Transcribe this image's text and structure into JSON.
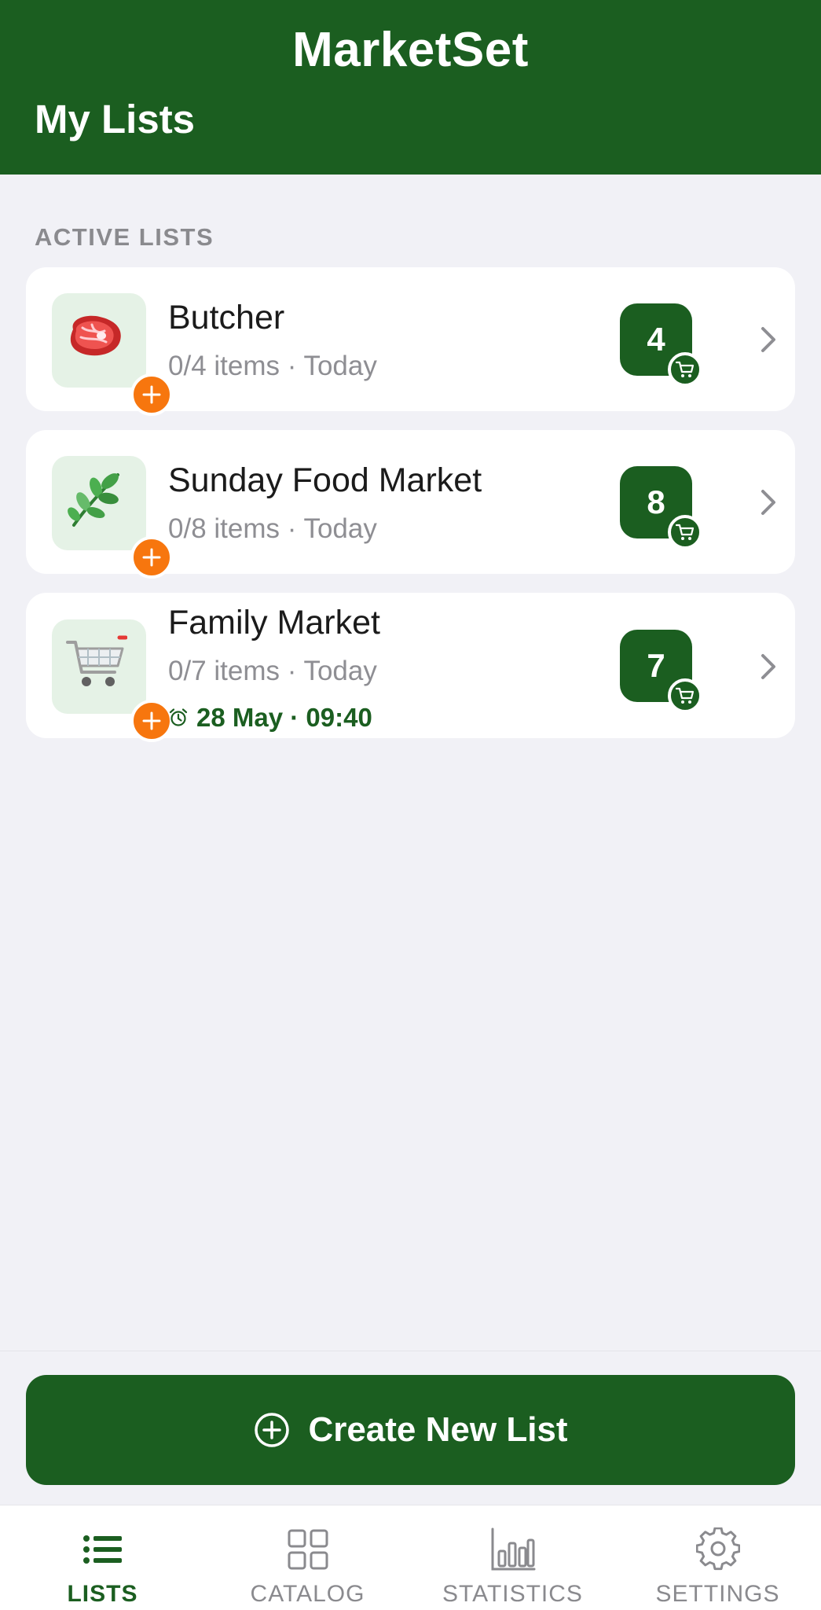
{
  "header": {
    "app_title": "MarketSet",
    "page_title": "My Lists"
  },
  "section_label": "ACTIVE LISTS",
  "lists": [
    {
      "title": "Butcher",
      "subtitle": "0/4 items · Today",
      "count": "4",
      "icon": "meat-icon"
    },
    {
      "title": "Sunday Food Market",
      "subtitle": "0/8 items · Today",
      "count": "8",
      "icon": "herb-icon"
    },
    {
      "title": "Family Market",
      "subtitle": "0/7 items · Today",
      "count": "7",
      "icon": "shopping-cart-icon",
      "reminder": "28 May · 09:40"
    }
  ],
  "create_button": {
    "label": "Create New List"
  },
  "nav": [
    {
      "label": "LISTS",
      "icon": "list-icon",
      "active": true
    },
    {
      "label": "CATALOG",
      "icon": "grid-icon",
      "active": false
    },
    {
      "label": "STATISTICS",
      "icon": "bar-chart-icon",
      "active": false
    },
    {
      "label": "SETTINGS",
      "icon": "gear-icon",
      "active": false
    }
  ],
  "colors": {
    "primary": "#1B5E20",
    "accent": "#F7760E",
    "background": "#F1F1F6",
    "muted_text": "#8E8E93"
  }
}
